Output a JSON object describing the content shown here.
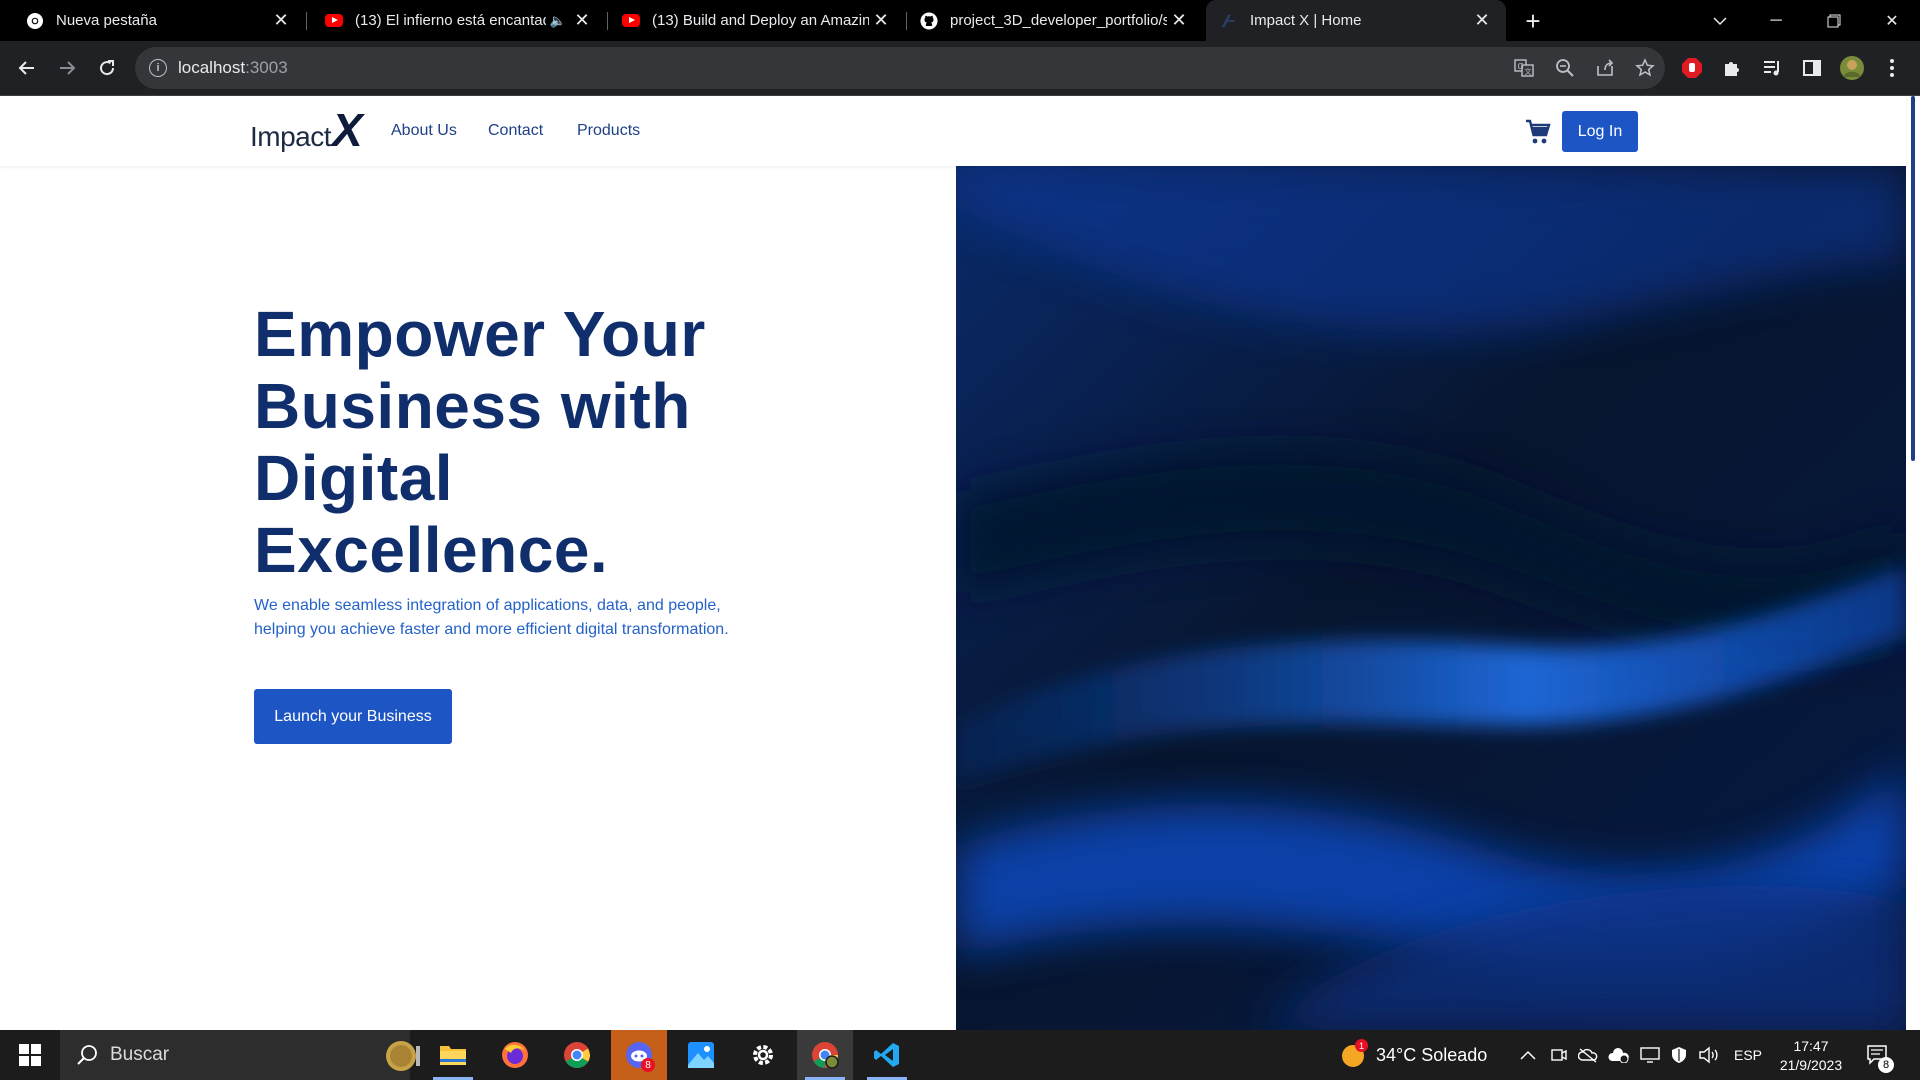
{
  "browser": {
    "tabs": [
      {
        "title": "Nueva pestaña",
        "icon": "chrome-icon"
      },
      {
        "title": "(13) El infierno está encantado",
        "icon": "youtube-icon"
      },
      {
        "title": "(13) Build and Deploy an Amazing",
        "icon": "youtube-icon"
      },
      {
        "title": "project_3D_developer_portfolio/s",
        "icon": "github-icon"
      },
      {
        "title": "Impact X | Home",
        "icon": "site-favicon"
      }
    ],
    "url_host": "localhost",
    "url_port": ":3003"
  },
  "site": {
    "logo_text": "Impact",
    "logo_mark": "X",
    "nav": [
      "About Us",
      "Contact",
      "Products"
    ],
    "login_label": "Log In",
    "headline": "Empower Your Business with Digital Excellence.",
    "subtext_line1": "We enable seamless integration of applications, data, and people,",
    "subtext_line2": "helping you achieve faster and more efficient digital transformation.",
    "cta_label": "Launch your Business"
  },
  "taskbar": {
    "search_label": "Buscar",
    "weather": "34°C  Soleado",
    "weather_badge": "1",
    "language": "ESP",
    "time": "17:47",
    "date": "21/9/2023",
    "notifications": "8",
    "badge_count": "8"
  },
  "colors": {
    "brand_blue": "#1d56c4",
    "headline_navy": "#0f2e6b",
    "chrome_dark": "#202124"
  }
}
